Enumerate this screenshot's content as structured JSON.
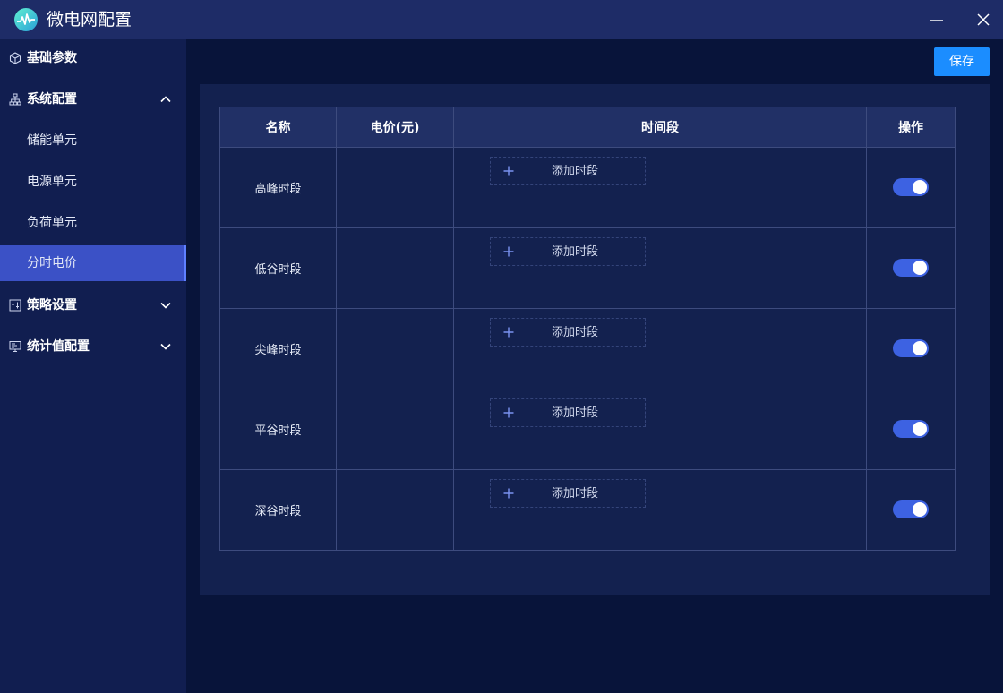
{
  "window": {
    "title": "微电网配置",
    "minimize_icon": "minimize-icon",
    "close_icon": "close-icon"
  },
  "sidebar": {
    "items": [
      {
        "label": "基础参数",
        "icon": "cube-icon",
        "level": 1
      },
      {
        "label": "系统配置",
        "icon": "sitemap-icon",
        "level": 1,
        "expanded": true
      },
      {
        "label": "储能单元",
        "level": 2
      },
      {
        "label": "电源单元",
        "level": 2
      },
      {
        "label": "负荷单元",
        "level": 2
      },
      {
        "label": "分时电价",
        "level": 2,
        "active": true
      },
      {
        "label": "策略设置",
        "icon": "strategy-icon",
        "level": 1,
        "expanded": false
      },
      {
        "label": "统计值配置",
        "icon": "monitor-icon",
        "level": 1,
        "expanded": false
      }
    ]
  },
  "toolbar": {
    "save_label": "保存"
  },
  "table": {
    "columns": [
      "名称",
      "电价(元)",
      "时间段",
      "操作"
    ],
    "add_period_label": "添加时段",
    "rows": [
      {
        "name": "高峰时段",
        "price": "",
        "enabled": true
      },
      {
        "name": "低谷时段",
        "price": "",
        "enabled": true
      },
      {
        "name": "尖峰时段",
        "price": "",
        "enabled": true
      },
      {
        "name": "平谷时段",
        "price": "",
        "enabled": true
      },
      {
        "name": "深谷时段",
        "price": "",
        "enabled": true
      }
    ]
  },
  "colors": {
    "accent": "#1b8dff",
    "active_nav": "#3b51c6",
    "switch_on": "#3d62e2",
    "background": "#08143a",
    "panel": "#13214f"
  }
}
